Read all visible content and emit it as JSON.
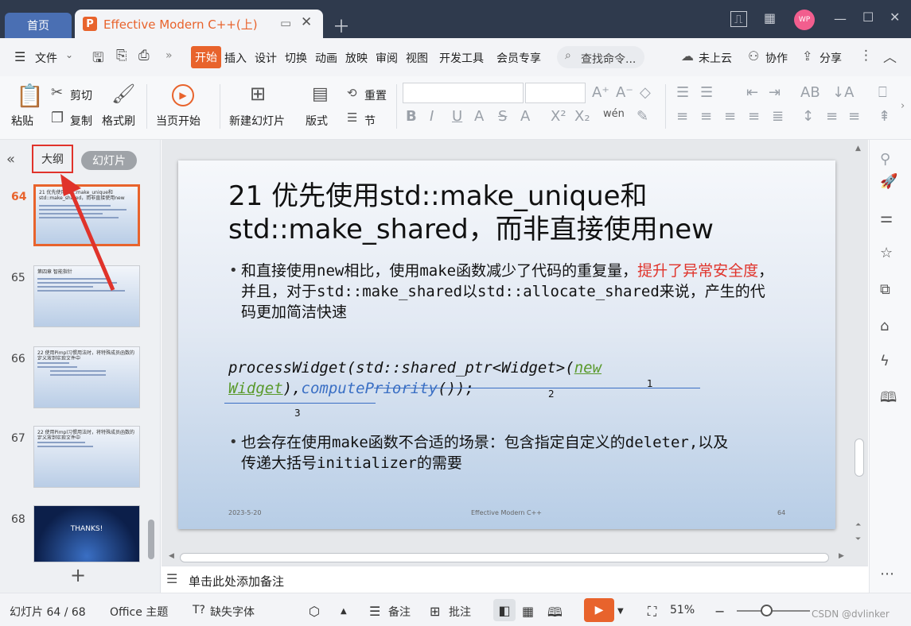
{
  "titlebar": {
    "home_tab": "首页",
    "doc_tab_title": "Effective Modern C++(上)",
    "doc_icon_letter": "P",
    "avatar": "WP"
  },
  "menubar": {
    "file": "文件",
    "tabs": [
      "开始",
      "插入",
      "设计",
      "切换",
      "动画",
      "放映",
      "审阅",
      "视图",
      "开发工具",
      "会员专享"
    ],
    "search_placeholder": "查找命令...",
    "cloud": "未上云",
    "collab": "协作",
    "share": "分享"
  },
  "ribbon": {
    "paste": "粘贴",
    "cut": "剪切",
    "copy": "复制",
    "format_painter": "格式刷",
    "start_from_current": "当页开始",
    "new_slide": "新建幻灯片",
    "layout": "版式",
    "section": "节",
    "reset": "重置"
  },
  "leftpanel": {
    "outline_tab": "大纲",
    "slides_tab": "幻灯片",
    "thumbnails": [
      {
        "num": "64",
        "title": "21 优先使用std::make_unique和std::make_shared，而非直接使用new",
        "selected": true
      },
      {
        "num": "65",
        "title": "第四章 智能指针",
        "selected": false
      },
      {
        "num": "66",
        "title": "22 使用Pimpl习惯用法时，将特殊成员函数的定义放到实现文件中",
        "selected": false
      },
      {
        "num": "67",
        "title": "22 使用Pimpl习惯用法时，将特殊成员函数的定义放到实现文件中",
        "selected": false
      },
      {
        "num": "68",
        "title": "THANKS!",
        "selected": false
      }
    ],
    "add_label": "+"
  },
  "slide": {
    "title_line1": "21 优先使用std::make_unique和",
    "title_line2": "std::make_shared，而非直接使用new",
    "bullet1_part1": "和直接使用new相比，使用make函数减少了代码的重复量，",
    "bullet1_red": "提升了异常安全度",
    "bullet1_part2": "，并且，对于std::make_shared以std::allocate_shared来说，产生的代码更加简洁快速",
    "code_prefix": "processWidget(std::shared_ptr<Widget>(",
    "code_green": "new Widget",
    "code_mid": "),",
    "code_blue": "computePriority",
    "code_suffix": "());",
    "marker1": "1",
    "marker2": "2",
    "marker3": "3",
    "bullet2": "也会存在使用make函数不合适的场景：包含指定自定义的deleter,以及传递大括号initializer的需要",
    "footer_date": "2023-5-20",
    "footer_title": "Effective Modern C++",
    "footer_page": "64"
  },
  "notes_placeholder": "单击此处添加备注",
  "statusbar": {
    "slide_counter": "幻灯片 64 / 68",
    "theme": "Office 主题",
    "missing_fonts": "缺失字体",
    "notes": "备注",
    "comments": "批注",
    "zoom": "51%",
    "watermark": "CSDN @dvlinker"
  },
  "colors": {
    "accent": "#e8632c",
    "titlebar_bg": "#2f3a4d",
    "red_text": "#e0332b",
    "green_text": "#5a9a2c",
    "blue_text": "#3a6fc4"
  }
}
